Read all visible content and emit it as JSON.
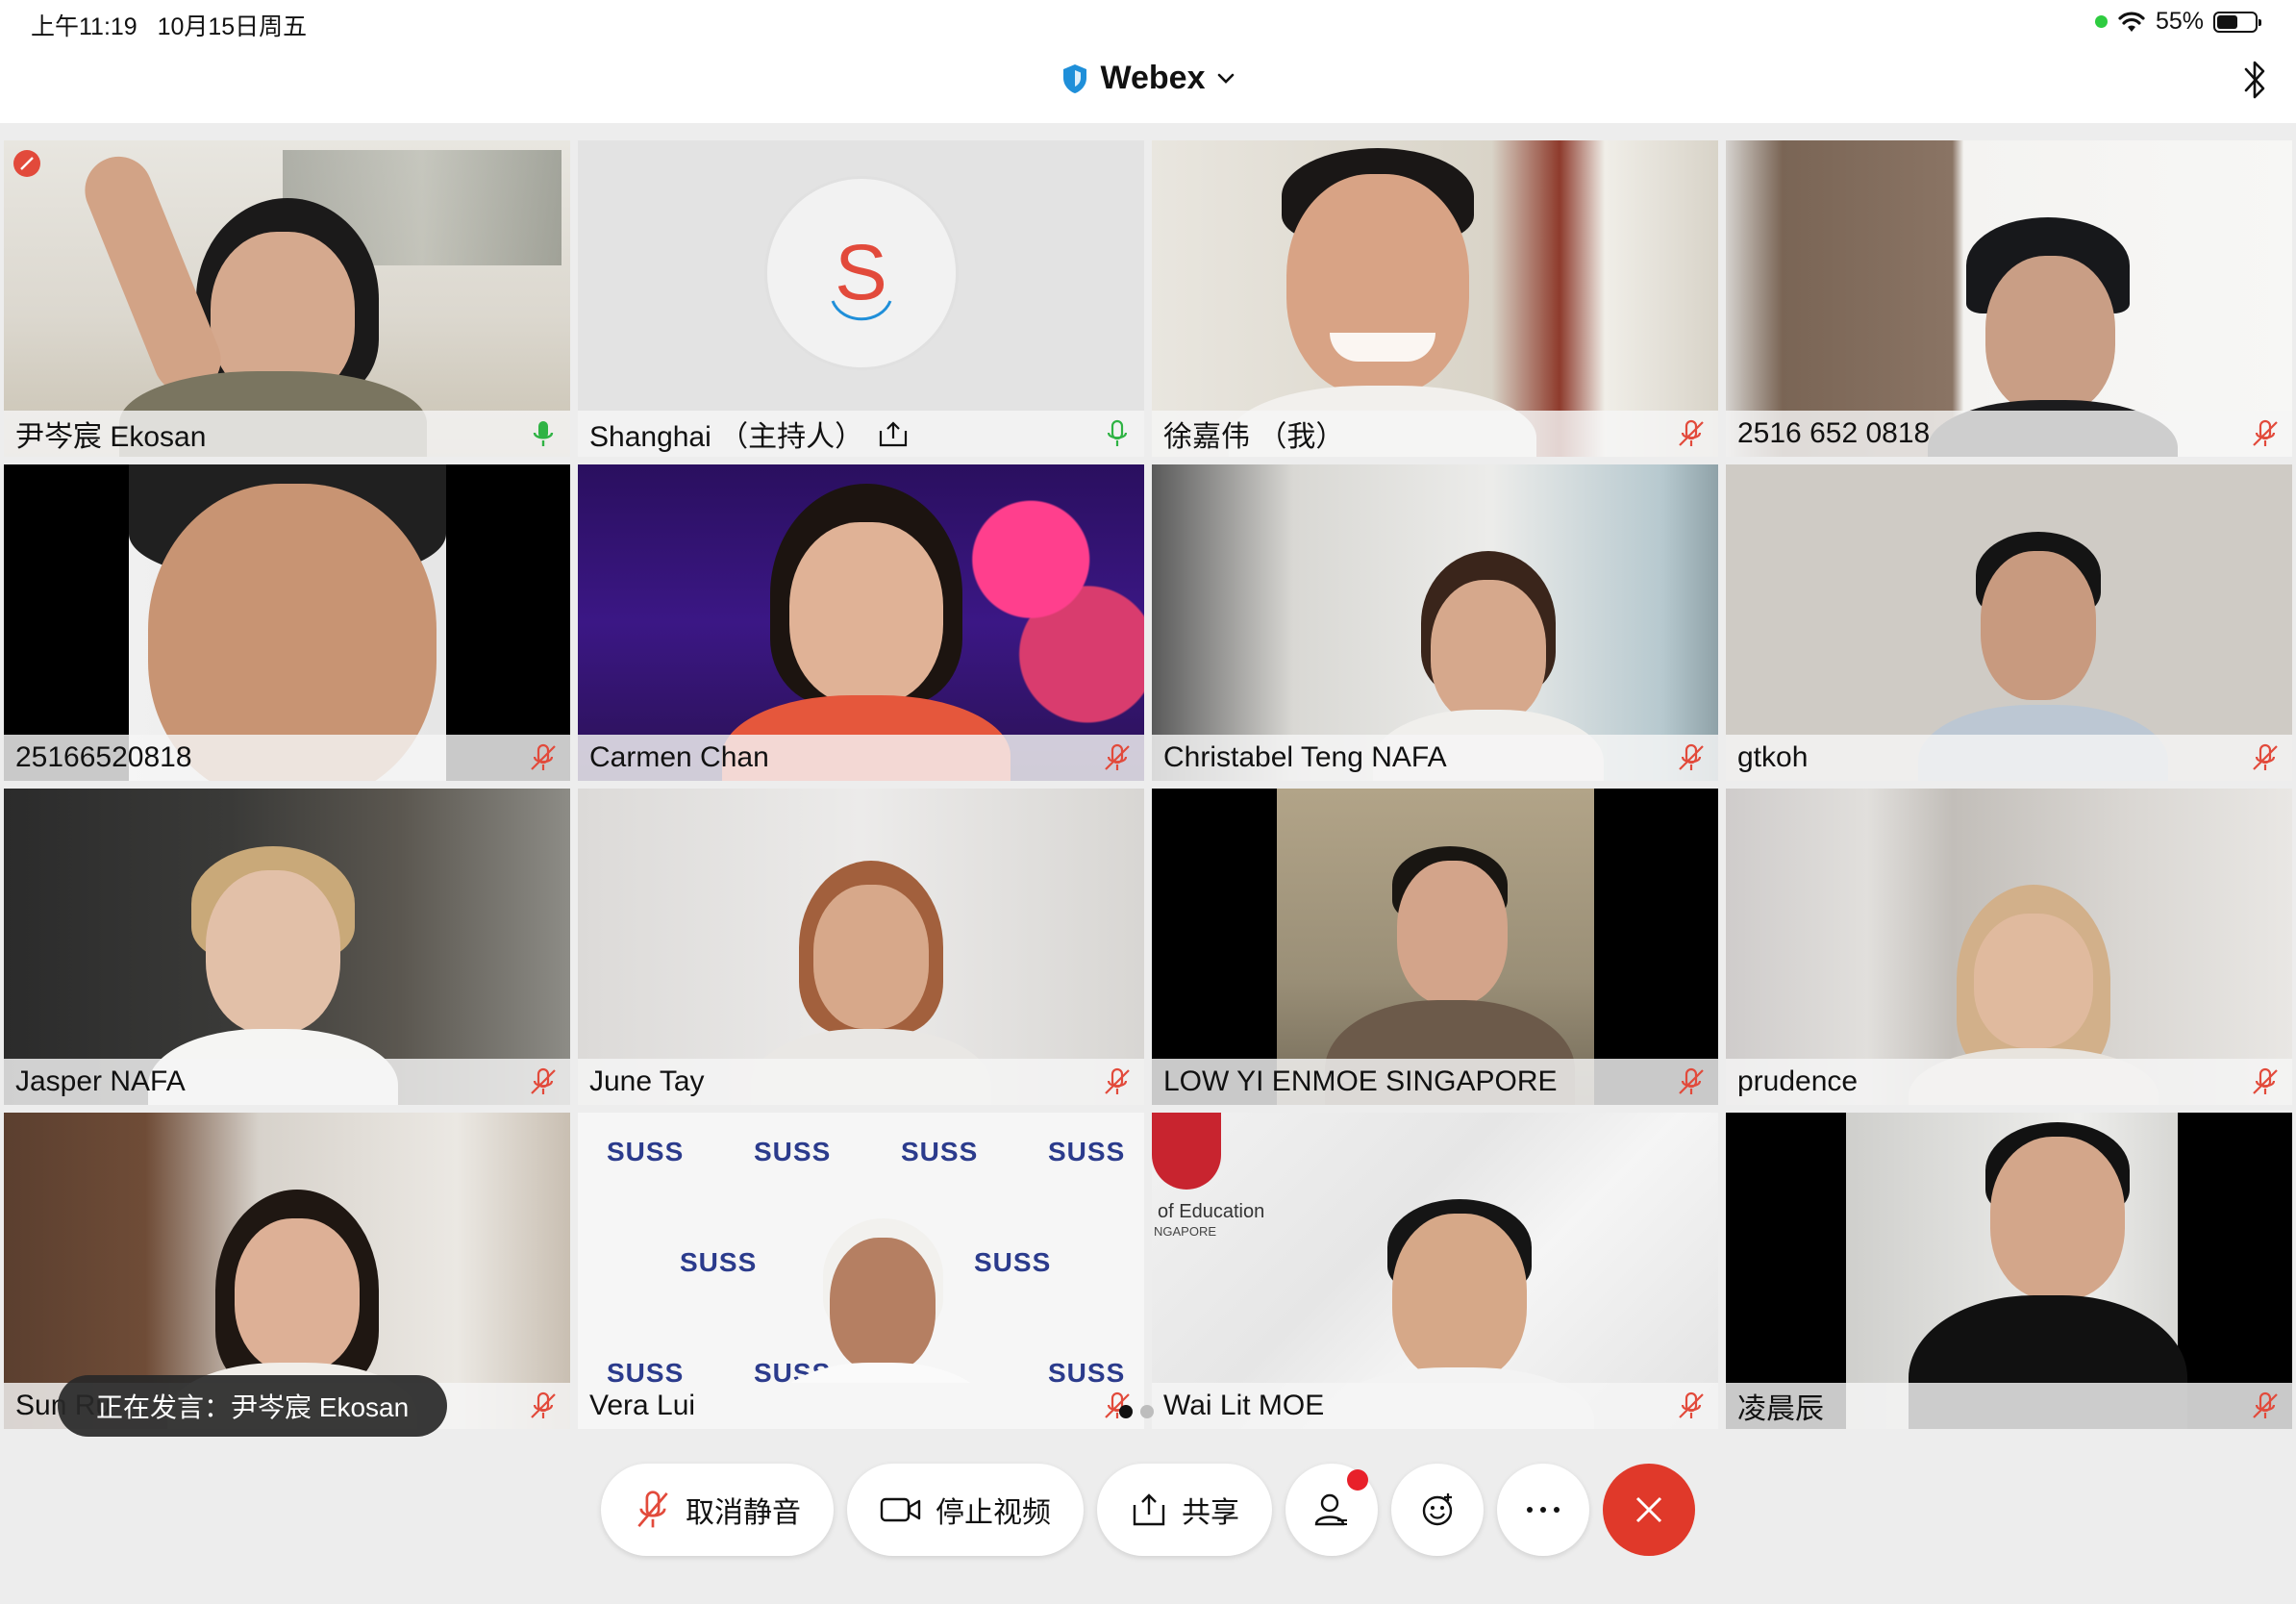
{
  "status_bar": {
    "time": "上午11:19",
    "date": "10月15日周五",
    "battery": "55%",
    "battery_level": 0.55
  },
  "header": {
    "title": "Webex"
  },
  "participants": [
    {
      "name": "尹岑宸 Ekosan",
      "mic": "active"
    },
    {
      "name": "Shanghai （主持人）",
      "mic": "unmuted",
      "avatar_letter": "S",
      "sharing": true
    },
    {
      "name": "徐嘉伟 （我）",
      "mic": "muted"
    },
    {
      "name": "2516 652 0818",
      "mic": "muted"
    },
    {
      "name": "25166520818",
      "mic": "muted"
    },
    {
      "name": "Carmen Chan",
      "mic": "muted"
    },
    {
      "name": "Christabel Teng NAFA",
      "mic": "muted"
    },
    {
      "name": "gtkoh",
      "mic": "muted"
    },
    {
      "name": "Jasper NAFA",
      "mic": "muted"
    },
    {
      "name": "June Tay",
      "mic": "muted"
    },
    {
      "name": "LOW YI ENMOE SINGAPORE",
      "mic": "muted"
    },
    {
      "name": "prudence",
      "mic": "muted"
    },
    {
      "name": "Sun Ru",
      "mic": "muted"
    },
    {
      "name": "Vera Lui",
      "mic": "muted"
    },
    {
      "name": "Wai Lit MOE",
      "mic": "muted"
    },
    {
      "name": "凌晨辰",
      "mic": "muted"
    }
  ],
  "backdrops": {
    "suss_logo": "SUSS",
    "moe_text": "of Education",
    "moe_sub": "NGAPORE"
  },
  "speaker_toast": "正在发言：尹岑宸 Ekosan",
  "controls": {
    "unmute_label": "取消静音",
    "stop_video_label": "停止视频",
    "share_label": "共享"
  },
  "colors": {
    "active_border": "#1f8fd9",
    "end_call": "#e0392a",
    "muted_mic": "#e24a3b",
    "unmuted_mic": "#2fb344"
  }
}
